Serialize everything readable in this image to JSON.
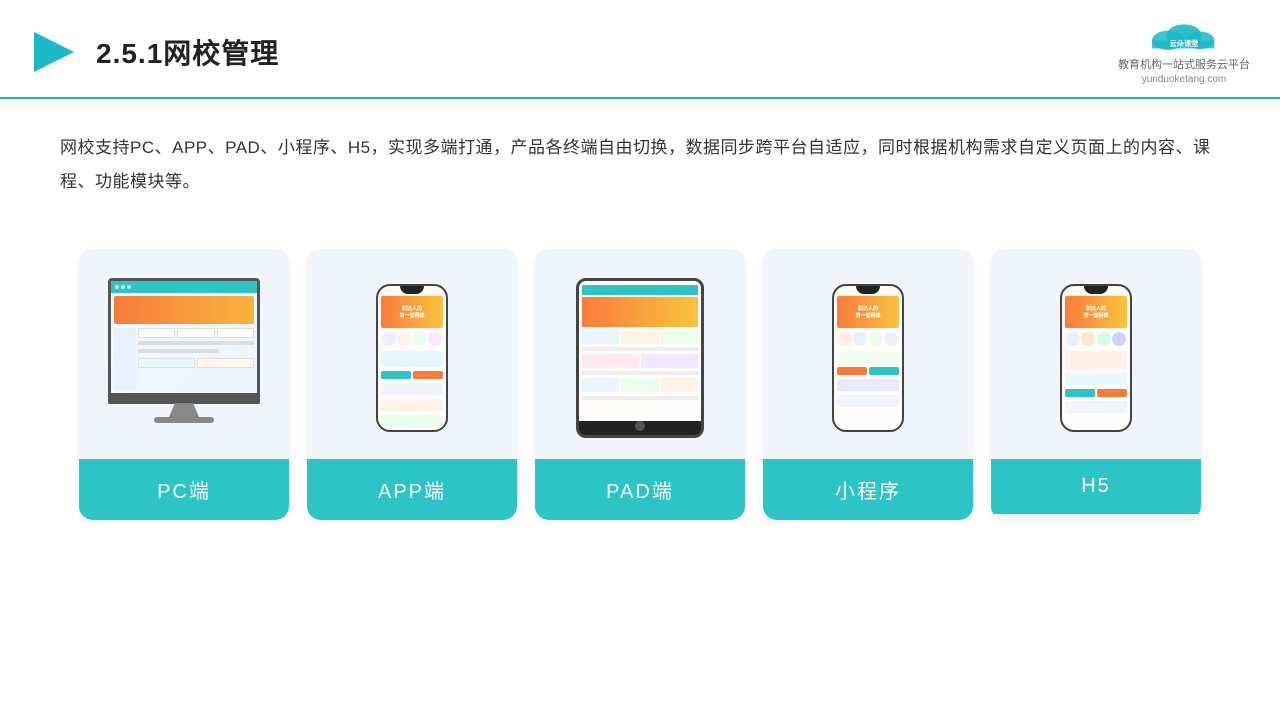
{
  "header": {
    "title": "2.5.1网校管理",
    "logo": {
      "name": "云朵课堂",
      "url": "yunduoketang.com",
      "tagline": "教育机构一站式服务云平台"
    }
  },
  "description": "网校支持PC、APP、PAD、小程序、H5，实现多端打通，产品各终端自由切换，数据同步跨平台自适应，同时根据机构需求自定义页面上的内容、课程、功能模块等。",
  "cards": [
    {
      "id": "pc",
      "label": "PC端",
      "type": "monitor"
    },
    {
      "id": "app",
      "label": "APP端",
      "type": "phone"
    },
    {
      "id": "pad",
      "label": "PAD端",
      "type": "tablet"
    },
    {
      "id": "miniapp",
      "label": "小程序",
      "type": "phone"
    },
    {
      "id": "h5",
      "label": "H5",
      "type": "phone"
    }
  ],
  "colors": {
    "accent": "#2cc4c4",
    "headerBorder": "#1ab8c8",
    "cardBg": "#f0f4fb",
    "labelBg": "#2cc4c4"
  }
}
